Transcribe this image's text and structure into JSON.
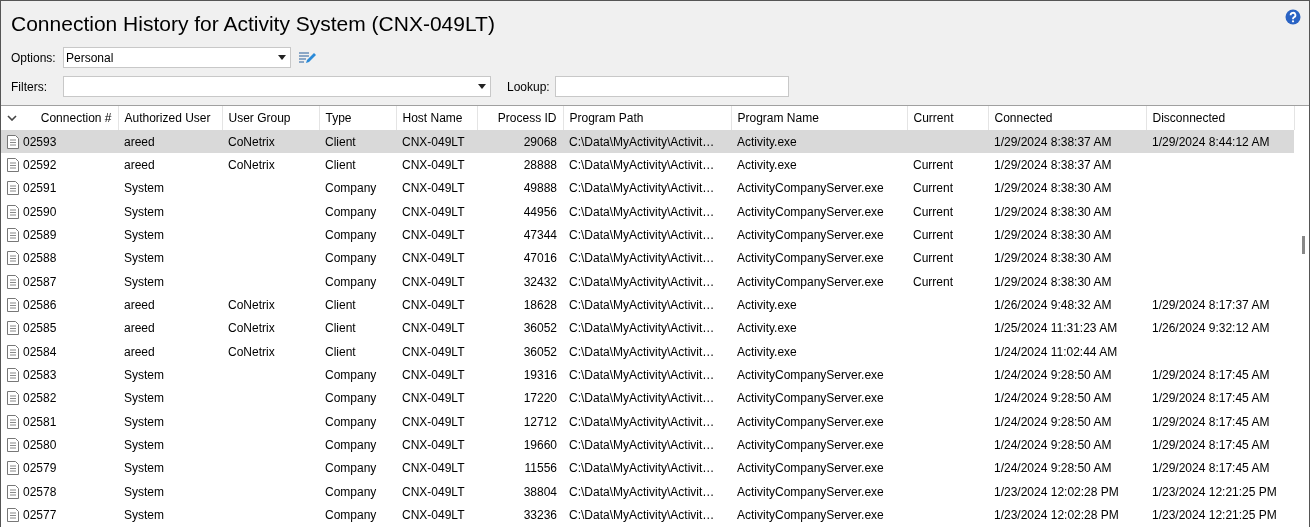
{
  "title": "Connection History for Activity System (CNX-049LT)",
  "options": {
    "label": "Options:",
    "value": "Personal"
  },
  "filters": {
    "label": "Filters:"
  },
  "lookup": {
    "label": "Lookup:"
  },
  "table": {
    "columns": [
      "Connection #",
      "Authorized User",
      "User Group",
      "Type",
      "Host Name",
      "Process ID",
      "Program Path",
      "Program Name",
      "Current",
      "Connected",
      "Disconnected"
    ],
    "rows": [
      {
        "selected": true,
        "connection": "02593",
        "user": "areed",
        "group": "CoNetrix",
        "type": "Client",
        "host": "CNX-049LT",
        "pid": "29068",
        "path": "C:\\Data\\MyActivity\\Activit…",
        "program": "Activity.exe",
        "connected": "1/29/2024 8:38:37 AM",
        "disconnected": "1/29/2024 8:44:12 AM"
      },
      {
        "selected": false,
        "connection": "02592",
        "user": "areed",
        "group": "CoNetrix",
        "type": "Client",
        "host": "CNX-049LT",
        "pid": "28888",
        "path": "C:\\Data\\MyActivity\\Activit…",
        "program": "Activity.exe",
        "current": "Current",
        "connected": "1/29/2024 8:38:37 AM"
      },
      {
        "selected": false,
        "connection": "02591",
        "user": "System",
        "type": "Company",
        "host": "CNX-049LT",
        "pid": "49888",
        "path": "C:\\Data\\MyActivity\\Activit…",
        "program": "ActivityCompanyServer.exe",
        "current": "Current",
        "connected": "1/29/2024 8:38:30 AM"
      },
      {
        "selected": false,
        "connection": "02590",
        "user": "System",
        "type": "Company",
        "host": "CNX-049LT",
        "pid": "44956",
        "path": "C:\\Data\\MyActivity\\Activit…",
        "program": "ActivityCompanyServer.exe",
        "current": "Current",
        "connected": "1/29/2024 8:38:30 AM"
      },
      {
        "selected": false,
        "connection": "02589",
        "user": "System",
        "type": "Company",
        "host": "CNX-049LT",
        "pid": "47344",
        "path": "C:\\Data\\MyActivity\\Activit…",
        "program": "ActivityCompanyServer.exe",
        "current": "Current",
        "connected": "1/29/2024 8:38:30 AM"
      },
      {
        "selected": false,
        "connection": "02588",
        "user": "System",
        "type": "Company",
        "host": "CNX-049LT",
        "pid": "47016",
        "path": "C:\\Data\\MyActivity\\Activit…",
        "program": "ActivityCompanyServer.exe",
        "current": "Current",
        "connected": "1/29/2024 8:38:30 AM"
      },
      {
        "selected": false,
        "connection": "02587",
        "user": "System",
        "type": "Company",
        "host": "CNX-049LT",
        "pid": "32432",
        "path": "C:\\Data\\MyActivity\\Activit…",
        "program": "ActivityCompanyServer.exe",
        "current": "Current",
        "connected": "1/29/2024 8:38:30 AM"
      },
      {
        "selected": false,
        "connection": "02586",
        "user": "areed",
        "group": "CoNetrix",
        "type": "Client",
        "host": "CNX-049LT",
        "pid": "18628",
        "path": "C:\\Data\\MyActivity\\Activit…",
        "program": "Activity.exe",
        "connected": "1/26/2024 9:48:32 AM",
        "disconnected": "1/29/2024 8:17:37 AM"
      },
      {
        "selected": false,
        "connection": "02585",
        "user": "areed",
        "group": "CoNetrix",
        "type": "Client",
        "host": "CNX-049LT",
        "pid": "36052",
        "path": "C:\\Data\\MyActivity\\Activit…",
        "program": "Activity.exe",
        "connected": "1/25/2024 11:31:23 AM",
        "disconnected": "1/26/2024 9:32:12 AM"
      },
      {
        "selected": false,
        "connection": "02584",
        "user": "areed",
        "group": "CoNetrix",
        "type": "Client",
        "host": "CNX-049LT",
        "pid": "36052",
        "path": "C:\\Data\\MyActivity\\Activit…",
        "program": "Activity.exe",
        "connected": "1/24/2024 11:02:44 AM"
      },
      {
        "selected": false,
        "connection": "02583",
        "user": "System",
        "type": "Company",
        "host": "CNX-049LT",
        "pid": "19316",
        "path": "C:\\Data\\MyActivity\\Activit…",
        "program": "ActivityCompanyServer.exe",
        "connected": "1/24/2024 9:28:50 AM",
        "disconnected": "1/29/2024 8:17:45 AM"
      },
      {
        "selected": false,
        "connection": "02582",
        "user": "System",
        "type": "Company",
        "host": "CNX-049LT",
        "pid": "17220",
        "path": "C:\\Data\\MyActivity\\Activit…",
        "program": "ActivityCompanyServer.exe",
        "connected": "1/24/2024 9:28:50 AM",
        "disconnected": "1/29/2024 8:17:45 AM"
      },
      {
        "selected": false,
        "connection": "02581",
        "user": "System",
        "type": "Company",
        "host": "CNX-049LT",
        "pid": "12712",
        "path": "C:\\Data\\MyActivity\\Activit…",
        "program": "ActivityCompanyServer.exe",
        "connected": "1/24/2024 9:28:50 AM",
        "disconnected": "1/29/2024 8:17:45 AM"
      },
      {
        "selected": false,
        "connection": "02580",
        "user": "System",
        "type": "Company",
        "host": "CNX-049LT",
        "pid": "19660",
        "path": "C:\\Data\\MyActivity\\Activit…",
        "program": "ActivityCompanyServer.exe",
        "connected": "1/24/2024 9:28:50 AM",
        "disconnected": "1/29/2024 8:17:45 AM"
      },
      {
        "selected": false,
        "connection": "02579",
        "user": "System",
        "type": "Company",
        "host": "CNX-049LT",
        "pid": "11556",
        "path": "C:\\Data\\MyActivity\\Activit…",
        "program": "ActivityCompanyServer.exe",
        "connected": "1/24/2024 9:28:50 AM",
        "disconnected": "1/29/2024 8:17:45 AM"
      },
      {
        "selected": false,
        "connection": "02578",
        "user": "System",
        "type": "Company",
        "host": "CNX-049LT",
        "pid": "38804",
        "path": "C:\\Data\\MyActivity\\Activit…",
        "program": "ActivityCompanyServer.exe",
        "connected": "1/23/2024 12:02:28 PM",
        "disconnected": "1/23/2024 12:21:25 PM"
      },
      {
        "selected": false,
        "connection": "02577",
        "user": "System",
        "type": "Company",
        "host": "CNX-049LT",
        "pid": "33236",
        "path": "C:\\Data\\MyActivity\\Activit…",
        "program": "ActivityCompanyServer.exe",
        "connected": "1/23/2024 12:02:28 PM",
        "disconnected": "1/23/2024 12:21:25 PM"
      }
    ]
  }
}
